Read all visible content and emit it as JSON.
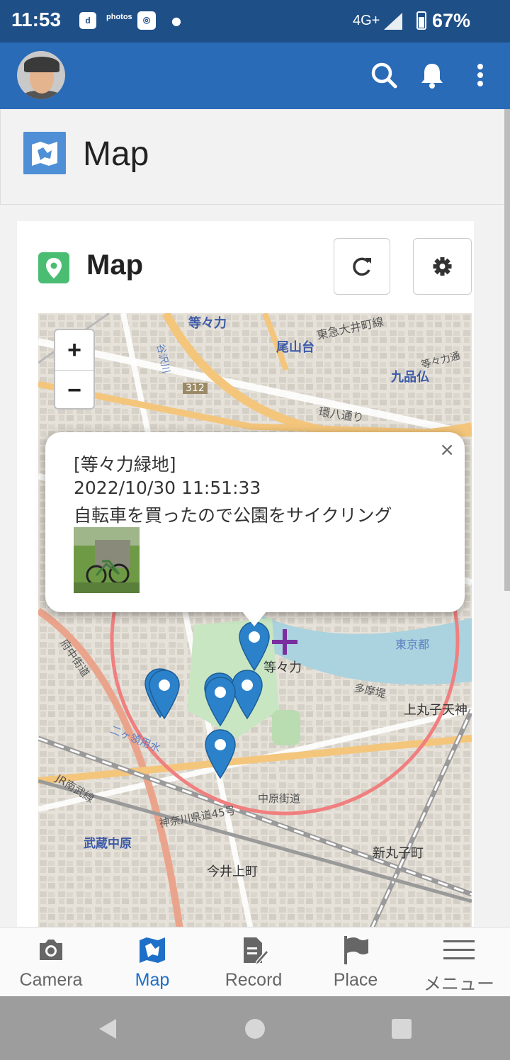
{
  "status_bar": {
    "time": "11:53",
    "notif_icons": [
      "d",
      "photos",
      "app"
    ],
    "network": "4G+",
    "battery": "67%"
  },
  "app_bar": {
    "actions": [
      "search-icon",
      "bell-icon",
      "more-vert-icon"
    ]
  },
  "page": {
    "title": "Map"
  },
  "card": {
    "title": "Map",
    "buttons": [
      "refresh-icon",
      "gear-icon"
    ]
  },
  "map": {
    "zoom_in": "+",
    "zoom_out": "−",
    "labels": {
      "todoroki_top": "等々力",
      "oyamadai": "尾山台",
      "kuhombutsu": "九品仏",
      "kanpachi": "環八通り",
      "todoroki": "等々力",
      "tokyo_to": "東京都",
      "tamatsutsumi": "多摩堤",
      "kamimaruko": "上丸子天神",
      "fuchu_kaido": "府中街道",
      "nakahara_kaido": "中原街道",
      "kanagawa45": "神奈川県道45号",
      "musashi_nakahara": "武蔵中原",
      "shinmaruko": "新丸子町",
      "imai_kamicho": "今井上町",
      "jr_nambu": "JR南武線",
      "route_312": "312",
      "ojiri": "谷沢川",
      "oimachi": "東急大井町線",
      "nikaryo": "二ヶ領用水",
      "todoroki_st": "等々力通"
    },
    "popup": {
      "place": "[等々力緑地]",
      "datetime": "2022/10/30 11:51:33",
      "text": "自転車を買ったので公園をサイクリング",
      "close": "×"
    },
    "colors": {
      "marker": "#2b82cb",
      "radius_circle": "#f07f7f",
      "crosshair": "#7a2ea0"
    }
  },
  "bottom_nav": {
    "items": [
      {
        "label": "Camera",
        "icon": "camera-icon"
      },
      {
        "label": "Map",
        "icon": "map-icon"
      },
      {
        "label": "Record",
        "icon": "record-icon"
      },
      {
        "label": "Place",
        "icon": "flag-icon"
      },
      {
        "label": "メニュー",
        "icon": "menu-icon"
      }
    ],
    "active": "Map"
  },
  "system_nav": [
    "back-icon",
    "home-icon",
    "recents-icon"
  ],
  "colors": {
    "status_bar": "#1e4f86",
    "app_bar": "#2a6bb8",
    "accent": "#1e6fc8",
    "card_icon": "#4bbd73"
  }
}
